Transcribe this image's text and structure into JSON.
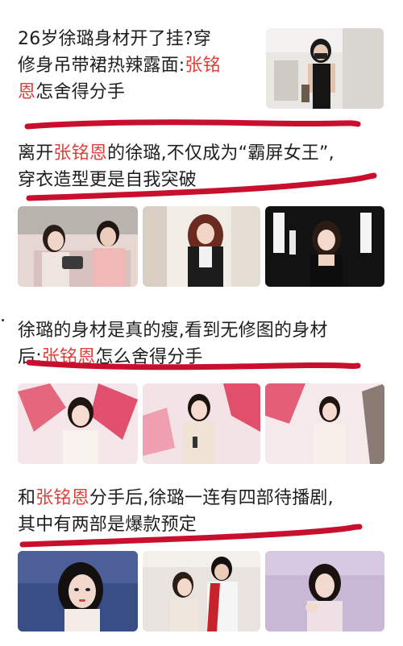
{
  "articles": [
    {
      "line1": "26岁徐璐身材开了挂?穿",
      "line2": "修身吊带裙热辣露面:",
      "line2_highlight": "张铭",
      "line3_highlight": "恩",
      "line3": "怎舍得分手"
    },
    {
      "line1_pre": "离开",
      "line1_highlight": "张铭恩",
      "line1_post": "的徐璐,不仅成为“霸屏女王”,",
      "line2": "穿衣造型更是自我突破"
    },
    {
      "line1": "徐璐的身材是真的瘦,看到无修图的身材",
      "line2_pre": "后:",
      "line2_highlight": "张铭恩",
      "line2_post": "怎么舍得分手"
    },
    {
      "line1_pre": "和",
      "line1_highlight": "张铭恩",
      "line1_post": "分手后,徐璐一连有四部待播剧,",
      "line2": "其中有两部是爆款预定"
    }
  ],
  "colors": {
    "highlight": "#e0403c",
    "underline": "#c8102e",
    "text": "#1f1f1f"
  }
}
